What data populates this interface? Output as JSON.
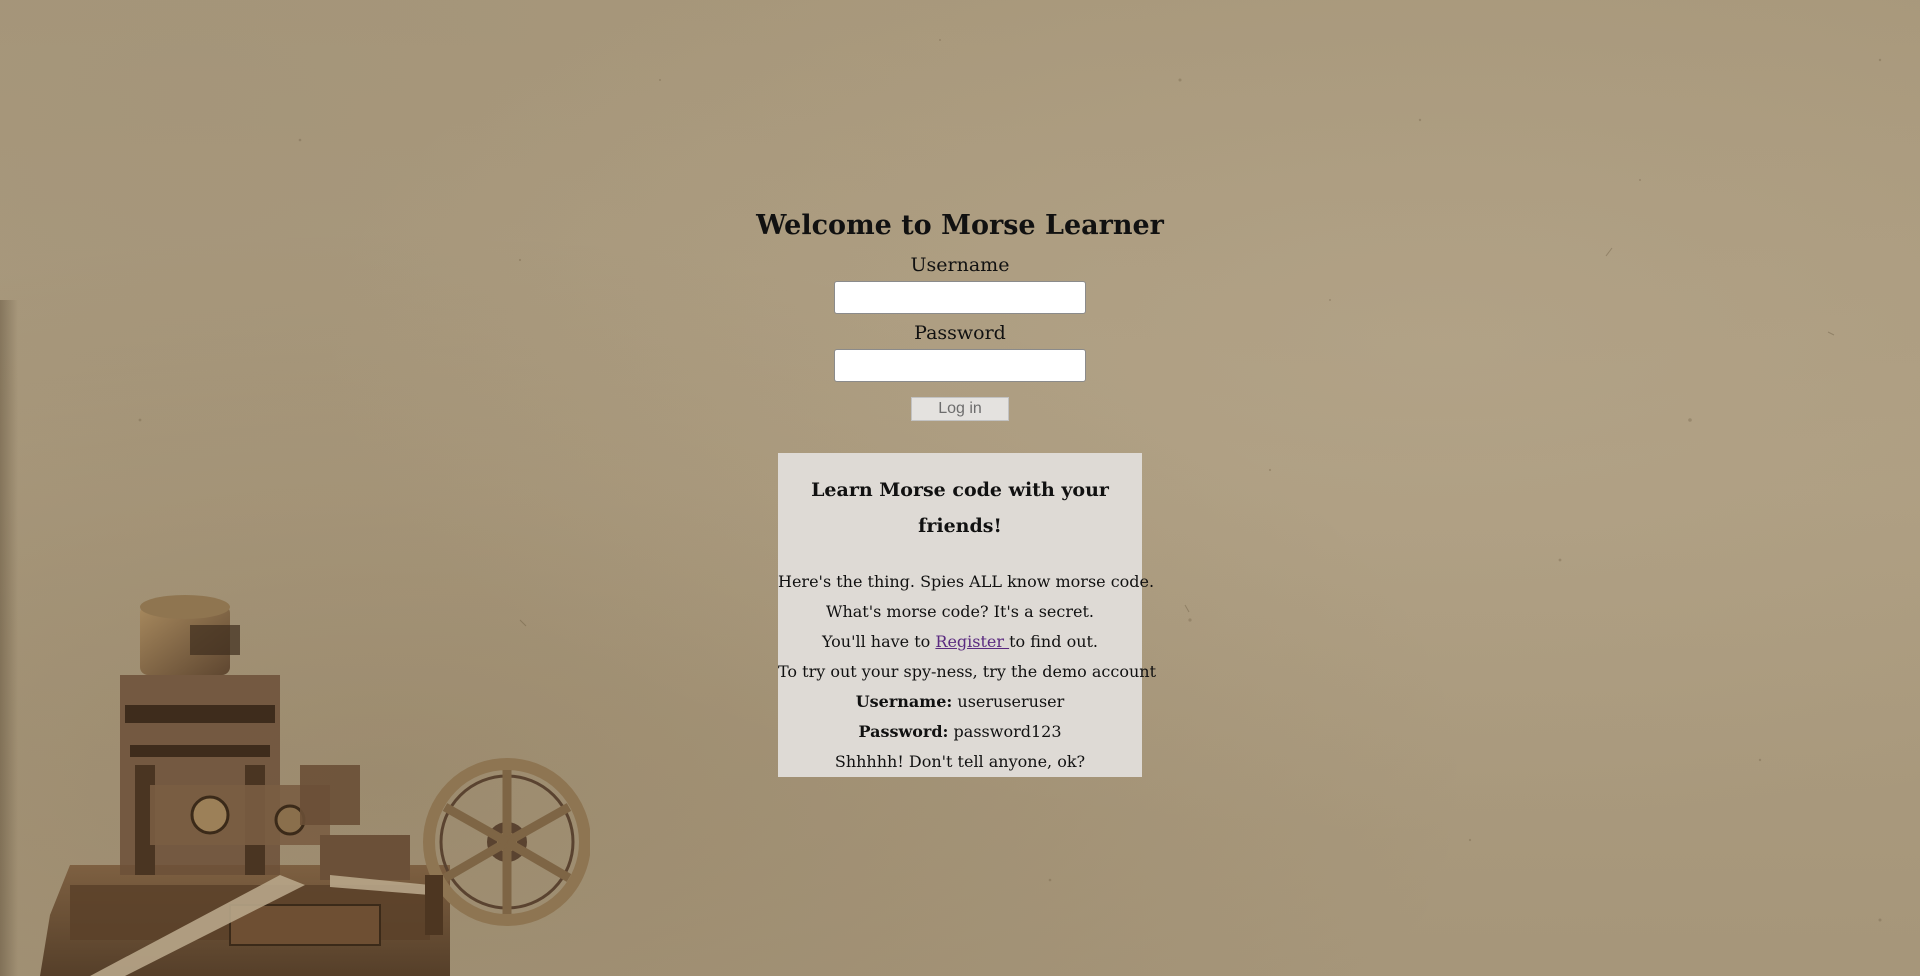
{
  "page": {
    "background_color": "#a9987a",
    "illustration": "telegraph-machine"
  },
  "login": {
    "title": "Welcome to Morse Learner",
    "username_label": "Username",
    "username_value": "",
    "password_label": "Password",
    "password_value": "",
    "submit_label": "Log in"
  },
  "info": {
    "heading": "Learn Morse code with your friends!",
    "line1": "Here's the thing. Spies ALL know morse code.",
    "line2": "What's morse code? It's a secret.",
    "line3_before": "You'll have to ",
    "register_link": "Register ",
    "line3_after": "to find out.",
    "line4": "To try out your spy-ness, try the demo account",
    "demo_username_label": "Username:",
    "demo_username_value": " useruseruser",
    "demo_password_label": "Password:",
    "demo_password_value": " password123",
    "line7": "Shhhhh! Don't tell anyone, ok?",
    "link_color": "#5a2a80",
    "box_color": "#dedad5"
  }
}
